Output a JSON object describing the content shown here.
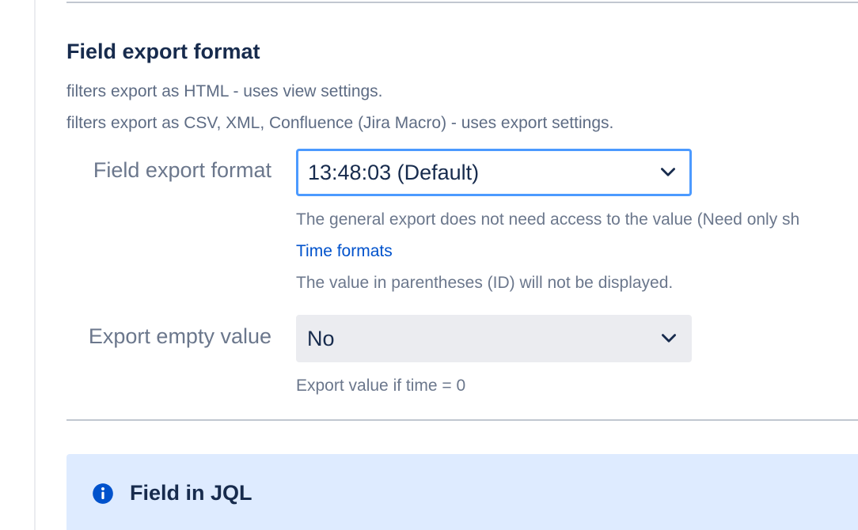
{
  "section": {
    "title": "Field export format",
    "desc_html": "filters export as HTML - uses view settings.",
    "desc_csv": "filters export as CSV, XML, Confluence (Jira Macro) - uses export settings."
  },
  "format_field": {
    "label": "Field export format",
    "selected": "13:48:03 (Default)",
    "help_access": "The general export does not need access to the value (Need only sh",
    "link_label": "Time formats",
    "help_parentheses": "The value in parentheses (ID) will not be displayed."
  },
  "empty_field": {
    "label": "Export empty value",
    "selected": "No",
    "help": "Export value if time = 0"
  },
  "info_panel": {
    "title": "Field in JQL",
    "icon": "info-icon"
  },
  "colors": {
    "link": "#0052cc",
    "focus_border": "#4c9aff",
    "info_background": "#deebff",
    "info_icon": "#0052cc"
  }
}
